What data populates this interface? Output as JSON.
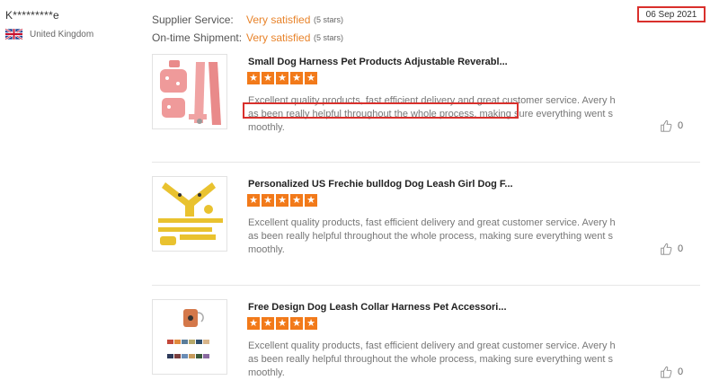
{
  "reviewer": {
    "name": "K*********e",
    "country": "United Kingdom",
    "flag_icon": "uk-flag-icon"
  },
  "ratings": [
    {
      "label": "Supplier Service:",
      "value": "Very satisfied",
      "stars": "(5 stars)"
    },
    {
      "label": "On-time Shipment:",
      "value": "Very satisfied",
      "stars": "(5 stars)"
    }
  ],
  "date": "06 Sep 2021",
  "star_rating": 5,
  "products": [
    {
      "title": "Small Dog Harness Pet Products Adjustable Reverabl...",
      "review": "Excellent quality products, fast efficient delivery and great customer service. Avery has been really helpful throughout the whole process, making sure everything went smoothly.",
      "likes": "0",
      "thumb_icon": "pink-harness-set-image"
    },
    {
      "title": "Personalized US Frechie bulldog Dog Leash Girl Dog F...",
      "review": "Excellent quality products, fast efficient delivery and great customer service. Avery has been really helpful throughout the whole process, making sure everything went smoothly.",
      "likes": "0",
      "thumb_icon": "yellow-harness-set-image"
    },
    {
      "title": "Free Design Dog Leash Collar Harness Pet Accessori...",
      "review": "Excellent quality products, fast efficient delivery and great customer service. Avery has been really helpful throughout the whole process, making sure everything went smoothly.",
      "likes": "0",
      "thumb_icon": "poop-bag-holder-image"
    }
  ],
  "colors": {
    "accent": "#f27a1a",
    "satisfied": "#e8832a",
    "highlight": "#d9302c"
  }
}
